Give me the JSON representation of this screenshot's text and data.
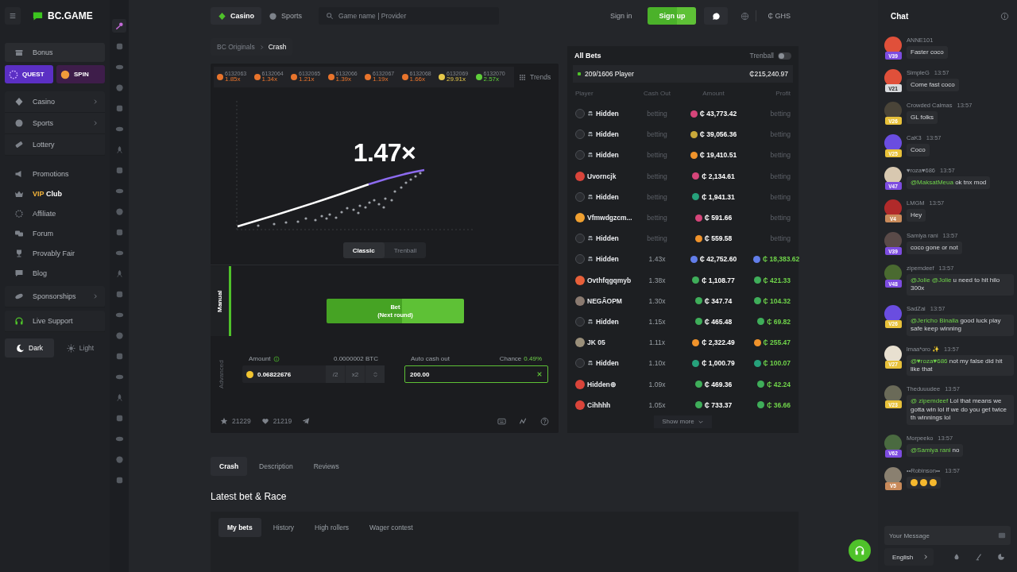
{
  "sidebar": {
    "brand": "BC.GAME",
    "bonus": {
      "label": "Bonus"
    },
    "promo_cards": [
      {
        "label": "QUEST",
        "color": "#5b2fc4"
      },
      {
        "label": "SPIN",
        "color": "#3e1d4a"
      }
    ],
    "groups": [
      {
        "boxed": true,
        "items": [
          {
            "label": "Casino",
            "submenu": true
          },
          {
            "label": "Sports",
            "submenu": true
          },
          {
            "label": "Lottery",
            "submenu": false
          }
        ]
      },
      {
        "boxed": false,
        "items": [
          {
            "label": "Promotions",
            "submenu": false
          },
          {
            "highlight": "VIP",
            "label": "Club",
            "submenu": false
          },
          {
            "label": "Affiliate",
            "submenu": false
          },
          {
            "label": "Forum",
            "submenu": false
          },
          {
            "label": "Provably Fair",
            "submenu": false
          },
          {
            "label": "Blog",
            "submenu": false
          }
        ]
      },
      {
        "boxed": true,
        "items": [
          {
            "label": "Sponsorships",
            "submenu": true
          }
        ]
      },
      {
        "boxed": true,
        "items": [
          {
            "label": "Live Support",
            "submenu": false
          }
        ]
      }
    ],
    "theme": [
      {
        "label": "Dark",
        "selected": true
      },
      {
        "label": "Light",
        "selected": false
      }
    ]
  },
  "game_rail": [
    {
      "selected": true
    },
    {
      "selected": false
    },
    {
      "selected": false
    },
    {
      "selected": false
    },
    {
      "selected": false
    },
    {
      "selected": false
    },
    {
      "selected": false
    },
    {
      "selected": false
    },
    {
      "selected": false
    },
    {
      "selected": false
    },
    {
      "selected": false
    },
    {
      "selected": false
    },
    {
      "selected": false
    },
    {
      "selected": false
    },
    {
      "selected": false
    },
    {
      "selected": false
    },
    {
      "selected": false
    },
    {
      "selected": false
    },
    {
      "selected": false
    },
    {
      "selected": false
    },
    {
      "selected": false
    },
    {
      "selected": false
    },
    {
      "selected": false
    }
  ],
  "topbar": {
    "tabs": [
      {
        "label": "Casino",
        "selected": true
      },
      {
        "label": "Sports",
        "selected": false
      }
    ],
    "search_placeholder": "Game name | Provider",
    "sign_in": "Sign in",
    "sign_up": "Sign up",
    "currency": "₵ GHS"
  },
  "game": {
    "breadcrumb": [
      "BC Originals",
      "Crash"
    ],
    "history": [
      {
        "round": "6132063",
        "multiplier": "1.85x",
        "color": "#e8742c"
      },
      {
        "round": "6132064",
        "multiplier": "1.34x",
        "color": "#e8742c"
      },
      {
        "round": "6132065",
        "multiplier": "1.21x",
        "color": "#e8742c"
      },
      {
        "round": "6132066",
        "multiplier": "1.39x",
        "color": "#e8742c"
      },
      {
        "round": "6132067",
        "multiplier": "1.19x",
        "color": "#e8742c"
      },
      {
        "round": "6132068",
        "multiplier": "1.66x",
        "color": "#e8742c"
      },
      {
        "round": "6132069",
        "multiplier": "29.91x",
        "color": "#e6c84a"
      },
      {
        "round": "6132070",
        "multiplier": "2.57x",
        "color": "#5fcf3a"
      }
    ],
    "trends": "Trends",
    "multiplier": "1.47×",
    "modes": [
      {
        "label": "Classic",
        "selected": true
      },
      {
        "label": "Trenball",
        "selected": false
      }
    ],
    "bet_tabs": [
      {
        "label": "Manual",
        "selected": true
      },
      {
        "label": "Advanced",
        "selected": false
      }
    ],
    "bet_button": {
      "label": "Bet",
      "sublabel": "(Next round)"
    },
    "amount": {
      "label": "Amount",
      "btc": "0.0000002 BTC",
      "value": "0.06822676",
      "half": "/2",
      "double": "x2"
    },
    "auto_cash_out": {
      "label": "Auto cash out",
      "chance_label": "Chance",
      "chance": "0.49%",
      "value": "200.00"
    },
    "favorites": "21229",
    "likes": "21219"
  },
  "bets": {
    "title": "All Bets",
    "trenball": {
      "label": "Trenball",
      "on": false
    },
    "players": "209/1606 Player",
    "total": "₵215,240.97",
    "columns": [
      "Player",
      "Cash Out",
      "Amount",
      "Profit"
    ],
    "rows": [
      {
        "player": "Hidden",
        "anonymous": true,
        "kind": "betting",
        "cash_out": "betting",
        "amount": "₵ 43,773.42",
        "profit": "betting"
      },
      {
        "player": "Hidden",
        "anonymous": true,
        "kind": "betting",
        "cash_out": "betting",
        "amount": "₵ 39,056.36",
        "profit": "betting"
      },
      {
        "player": "Hidden",
        "anonymous": true,
        "kind": "betting",
        "cash_out": "betting",
        "amount": "₵ 19,410.51",
        "profit": "betting"
      },
      {
        "player": "Uvorncjk",
        "anonymous": false,
        "kind": "betting",
        "cash_out": "betting",
        "amount": "₵ 2,134.61",
        "profit": "betting"
      },
      {
        "player": "Hidden",
        "anonymous": true,
        "kind": "betting",
        "cash_out": "betting",
        "amount": "₵ 1,941.31",
        "profit": "betting"
      },
      {
        "player": "Vfmwdgzcm...",
        "anonymous": false,
        "kind": "betting",
        "cash_out": "betting",
        "amount": "₵ 591.66",
        "profit": "betting"
      },
      {
        "player": "Hidden",
        "anonymous": true,
        "kind": "betting",
        "cash_out": "betting",
        "amount": "₵ 559.58",
        "profit": "betting"
      },
      {
        "player": "Hidden",
        "anonymous": true,
        "kind": "cashed",
        "cash_out": "1.43x",
        "amount": "₵ 42,752.60",
        "profit": "₵ 18,383.62"
      },
      {
        "player": "Ovthfqgqmyb",
        "anonymous": false,
        "kind": "cashed",
        "cash_out": "1.38x",
        "amount": "₵ 1,108.77",
        "profit": "₵ 421.33"
      },
      {
        "player": "NEGÃOPM",
        "anonymous": false,
        "kind": "cashed",
        "cash_out": "1.30x",
        "amount": "₵ 347.74",
        "profit": "₵ 104.32"
      },
      {
        "player": "Hidden",
        "anonymous": true,
        "kind": "cashed",
        "cash_out": "1.15x",
        "amount": "₵ 465.48",
        "profit": "₵ 69.82"
      },
      {
        "player": "JK 05",
        "anonymous": false,
        "kind": "cashed",
        "cash_out": "1.11x",
        "amount": "₵ 2,322.49",
        "profit": "₵ 255.47"
      },
      {
        "player": "Hidden",
        "anonymous": true,
        "kind": "cashed",
        "cash_out": "1.10x",
        "amount": "₵ 1,000.79",
        "profit": "₵ 100.07"
      },
      {
        "player": "Hidden⊕",
        "anonymous": false,
        "kind": "cashed",
        "cash_out": "1.09x",
        "amount": "₵ 469.36",
        "profit": "₵ 42.24"
      },
      {
        "player": "Cihhhh",
        "anonymous": false,
        "kind": "cashed",
        "cash_out": "1.05x",
        "amount": "₵ 733.37",
        "profit": "₵ 36.66"
      }
    ],
    "show_more": "Show more"
  },
  "lower": {
    "tabs": [
      {
        "label": "Crash",
        "selected": true
      },
      {
        "label": "Description",
        "selected": false
      },
      {
        "label": "Reviews",
        "selected": false
      }
    ],
    "section_title": "Latest bet & Race",
    "bet_tabs": [
      {
        "label": "My bets",
        "selected": true
      },
      {
        "label": "History",
        "selected": false
      },
      {
        "label": "High rollers",
        "selected": false
      },
      {
        "label": "Wager contest",
        "selected": false
      }
    ]
  },
  "chat": {
    "title": "Chat",
    "messages": [
      {
        "name": "ANNE101",
        "level": "V39",
        "text": "Faster coco"
      },
      {
        "name": "SimpleG",
        "time": "13:57",
        "level": "V21",
        "text": "Come fast coco"
      },
      {
        "name": "Crowded Calmas",
        "time": "13:57",
        "level": "V26",
        "text": "GL folks"
      },
      {
        "name": "CaK3",
        "time": "13:57",
        "level": "V25",
        "text": "Coco"
      },
      {
        "name": "♥roza♥686",
        "time": "13:57",
        "level": "V47",
        "mention": "@MaksatMeua",
        "text": " ok tnx mod"
      },
      {
        "name": "LMGM",
        "time": "13:57",
        "level": "V4",
        "text": "Hey"
      },
      {
        "name": "Samiya rani",
        "time": "13:57",
        "level": "V39",
        "text": "coco gone or not"
      },
      {
        "name": "zipemdeef",
        "time": "13:57",
        "level": "V48",
        "mention": "@Jolie @Jolie",
        "text": " u need to hit hilo 300x"
      },
      {
        "name": "SadZai",
        "time": "13:57",
        "level": "V26",
        "mention": "@Jericho Binalla",
        "text": " good luck play safe keep winning"
      },
      {
        "name": "lmaa*oro ✨",
        "time": "13:57",
        "level": "V27",
        "mention": "@♥roza♥686",
        "text": " not my false did hit like that"
      },
      {
        "name": "Theduuudee",
        "time": "13:57",
        "level": "V23",
        "mention": "@ zipemdeef",
        "text": " Lol that means we gotta win lol if we do you get twice th winnings lol"
      },
      {
        "name": "Morpeeko",
        "time": "13:57",
        "level": "V62",
        "mention": "@Samiya rani",
        "text": " no"
      },
      {
        "name": "••Robinson••",
        "time": "13:57",
        "level": "V5",
        "kind": "reactions"
      }
    ],
    "input_placeholder": "Your Message",
    "language": "English"
  }
}
